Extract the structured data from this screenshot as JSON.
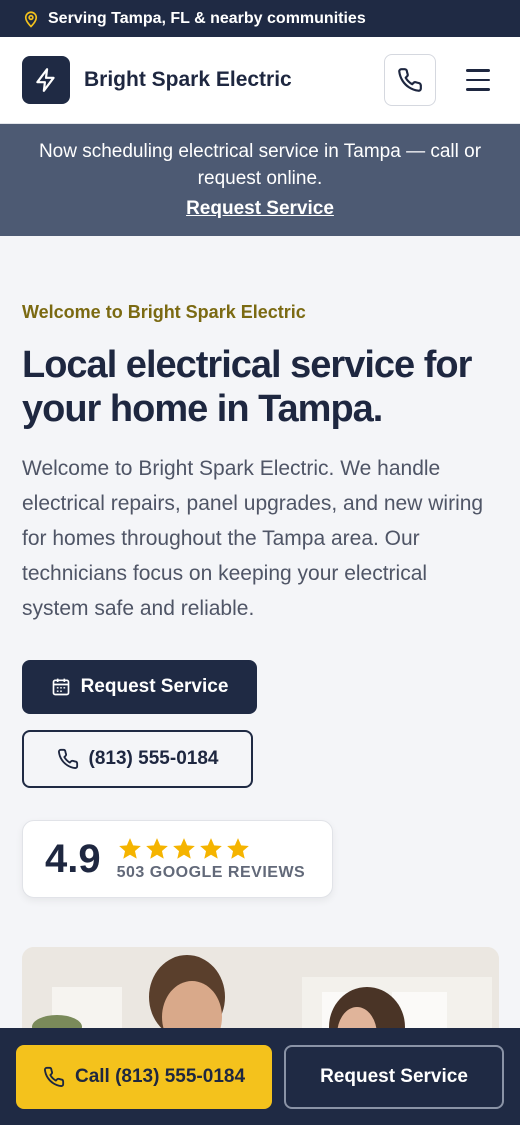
{
  "topbar": {
    "text": "Serving Tampa, FL & nearby communities",
    "icon": "map-pin-icon"
  },
  "header": {
    "brand": "Bright Spark Electric",
    "logo_icon": "lightning-bolt-icon",
    "phone_icon": "phone-icon",
    "menu_icon": "hamburger-menu-icon"
  },
  "announcement": {
    "text": "Now scheduling electrical service in Tampa — call or request online.",
    "link": "Request Service"
  },
  "hero": {
    "eyebrow": "Welcome to Bright Spark Electric",
    "headline": "Local electrical service for your home in Tampa.",
    "intro": "Welcome to Bright Spark Electric. We handle electrical repairs, panel upgrades, and new wiring for homes throughout the Tampa area. Our technicians focus on keeping your electrical system safe and reliable.",
    "primary_button": "Request Service",
    "phone_button": "(813) 555-0184"
  },
  "rating": {
    "score": "4.9",
    "stars": 5,
    "label": "503 GOOGLE REVIEWS"
  },
  "bottom_bar": {
    "call_button": "Call (813) 555-0184",
    "request_button": "Request Service"
  },
  "colors": {
    "navy": "#1f2a44",
    "accent_yellow": "#f4c21c",
    "eyebrow_gold": "#7b6a12",
    "star": "#f5b400"
  }
}
